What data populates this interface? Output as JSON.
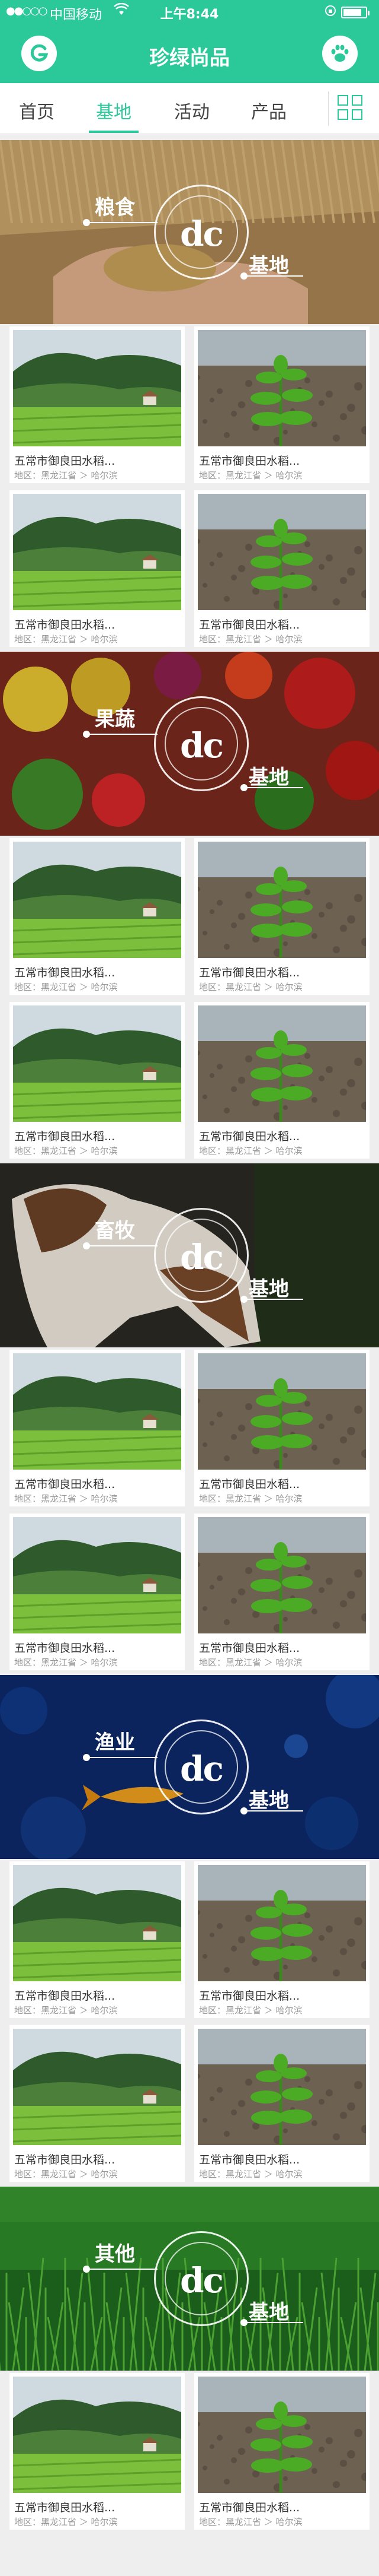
{
  "status_bar": {
    "signal": "●●○○○",
    "carrier": "中国移动",
    "time": "上午8:44"
  },
  "header": {
    "title": "珍绿尚品",
    "left_icon": "g-logo-icon",
    "right_icon": "paw-icon"
  },
  "tabs": [
    {
      "label": "首页",
      "active": false
    },
    {
      "label": "基地",
      "active": true
    },
    {
      "label": "活动",
      "active": false
    },
    {
      "label": "产品",
      "active": false
    }
  ],
  "product": {
    "name": "五常市御良田水稻...",
    "location": "地区：黑龙江省 ＞ 哈尔滨"
  },
  "sections": [
    {
      "category": "粮食",
      "logo": "dc",
      "base": "基地",
      "bg_color": "#a98552"
    },
    {
      "category": "果蔬",
      "logo": "dc",
      "base": "基地",
      "bg_color": "#7a2a1d"
    },
    {
      "category": "畜牧",
      "logo": "dc",
      "base": "基地",
      "bg_color": "#2c2a24"
    },
    {
      "category": "渔业",
      "logo": "dc",
      "base": "基地",
      "bg_color": "#0e2a6a"
    },
    {
      "category": "其他",
      "logo": "dc",
      "base": "基地",
      "bg_color": "#1f6a1e"
    }
  ],
  "colors": {
    "accent": "#2bc89a",
    "page_bg": "#eeeeee"
  }
}
